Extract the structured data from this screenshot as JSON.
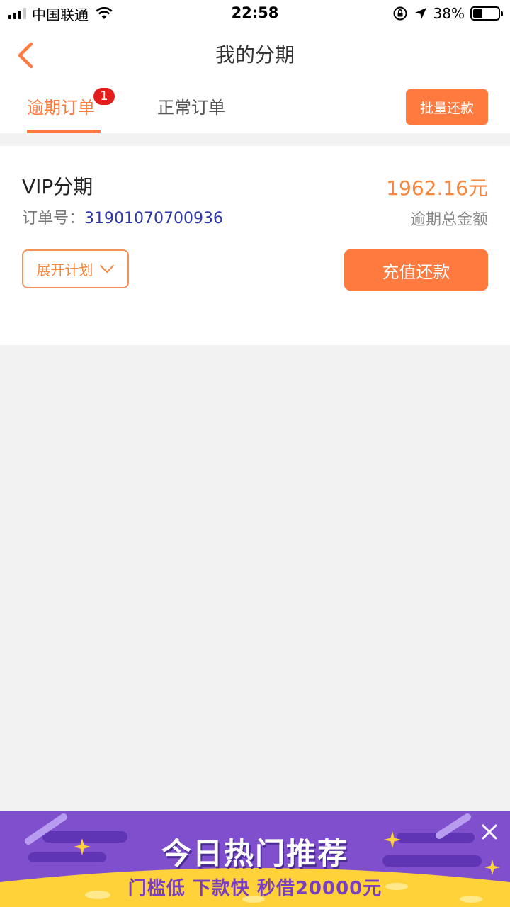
{
  "status_bar": {
    "carrier": "中国联通",
    "time": "22:58",
    "battery_pct": "38%",
    "battery_level": 0.38
  },
  "nav": {
    "title": "我的分期",
    "back_icon": "chevron-left-icon"
  },
  "tabs": {
    "overdue": "逾期订单",
    "overdue_badge": "1",
    "normal": "正常订单",
    "bulk_repay": "批量还款"
  },
  "order": {
    "title": "VIP分期",
    "amount": "1962.16元",
    "order_label": "订单号：",
    "order_number": "31901070700936",
    "amount_label": "逾期总金额",
    "expand_plan": "展开计划",
    "recharge_repay": "充值还款"
  },
  "banner": {
    "title": "今日热门推荐",
    "subtitle": "门槛低 下款快 秒借20000元"
  },
  "colors": {
    "accent": "#ff7a3f",
    "badge": "#e31c1c",
    "order_number": "#2d35a8",
    "banner_purple": "#7f4fce",
    "banner_yellow": "#ffd23a"
  }
}
